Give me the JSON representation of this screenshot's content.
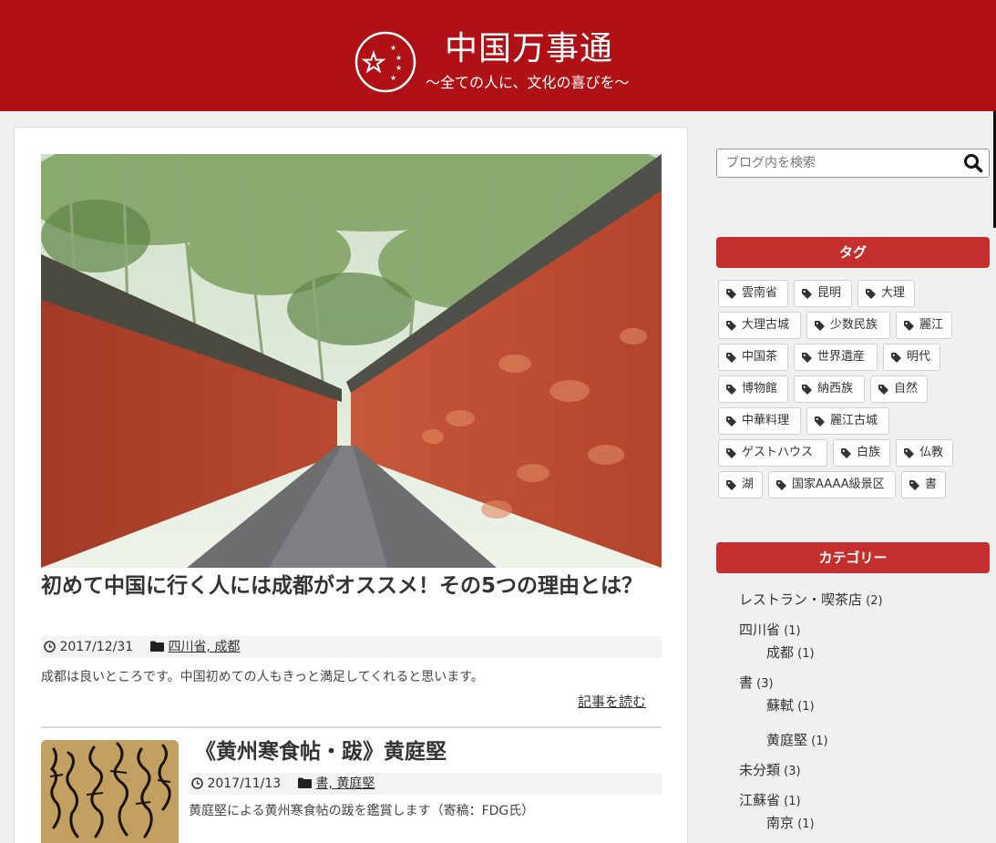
{
  "header": {
    "title": "中国万事通",
    "tagline": "〜全ての人に、文化の喜びを〜"
  },
  "posts": [
    {
      "title": "初めて中国に行く人には成都がオススメ！その5つの理由とは？",
      "date": "2017/12/31",
      "categories": "四川省, 成都",
      "excerpt": "成都は良いところです。中国初めての人もきっと満足してくれると思います。",
      "read_more": "記事を読む"
    },
    {
      "title": "《黄州寒食帖・跋》黄庭堅",
      "date": "2017/11/13",
      "categories": "書, 黄庭堅",
      "excerpt": "黄庭堅による黄州寒食帖の跋を鑑賞します（寄稿：FDG氏）"
    }
  ],
  "sidebar": {
    "search_placeholder": "ブログ内を検索",
    "tags_heading": "タグ",
    "tags": [
      "雲南省",
      "昆明",
      "大理",
      "大理古城",
      "少数民族",
      "麗江",
      "中国茶",
      "世界遺産",
      "明代",
      "博物館",
      "納西族",
      "自然",
      "中華料理",
      "麗江古城",
      "ゲストハウス",
      "白族",
      "仏教",
      "湖",
      "国家AAAA級景区",
      "書"
    ],
    "categories_heading": "カテゴリー",
    "categories": [
      {
        "label": "レストラン・喫茶店",
        "count": "(2)"
      },
      {
        "label": "四川省",
        "count": "(1)"
      },
      {
        "label": "成都",
        "count": "(1)"
      },
      {
        "label": "書",
        "count": "(3)"
      },
      {
        "label": "蘇軾",
        "count": "(1)"
      },
      {
        "label": "黄庭堅",
        "count": "(1)"
      },
      {
        "label": "未分類",
        "count": "(3)"
      },
      {
        "label": "江蘇省",
        "count": "(1)"
      },
      {
        "label": "南京",
        "count": "(1)"
      }
    ]
  },
  "icons": {
    "logo": "star-ring-icon",
    "clock": "clock-icon",
    "folder": "folder-icon",
    "tag": "tag-icon",
    "search": "search-icon"
  },
  "colors": {
    "header_bg": "#b01116",
    "widget_heading_bg": "#c5302f"
  }
}
